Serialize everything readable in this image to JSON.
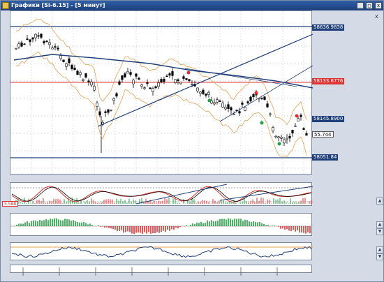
{
  "window": {
    "title": "Графики [Si-6.15] - [5 минут]",
    "buttons": {
      "minimize": "_",
      "maximize": "□",
      "close": "x"
    },
    "pane_close": "x"
  },
  "price_levels": [
    {
      "value": "58636.9838",
      "color": "#1f3f7a",
      "text_color": "#ffffff"
    },
    {
      "value": "58133.6776",
      "color": "#e03030",
      "text_color": "#ffffff"
    },
    {
      "value": "58145.8900",
      "color": "#1f3f7a",
      "text_color": "#ffffff"
    },
    {
      "value": "55.744",
      "color": "#ffffff",
      "text_color": "#000000"
    },
    {
      "value": "58051.84",
      "color": "#1f3f7a",
      "text_color": "#ffffff"
    }
  ],
  "stoch_label": "5.588",
  "colors": {
    "candle": "#000000",
    "bollinger": "#e8a050",
    "ma": "#1f3f7a",
    "trend": "#1f3f7a",
    "stoch_k": "#e03030",
    "stoch_d": "#000000",
    "hist_up": "#20a040",
    "hist_down": "#e03030",
    "rsi": "#1f3f7a",
    "rsi_ref": "#e8a050"
  }
}
